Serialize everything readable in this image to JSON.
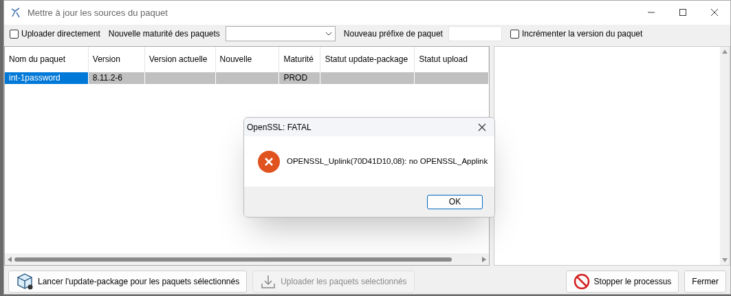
{
  "window": {
    "title": "Mettre à jour les sources du paquet"
  },
  "options": [
    {
      "kind": "checkbox",
      "label": "Uploader directement",
      "checked": false
    },
    {
      "kind": "dropdown",
      "label": "Nouvelle maturité des paquets"
    },
    {
      "kind": "textfield",
      "label": "Nouveau préfixe de paquet"
    },
    {
      "kind": "checkbox",
      "label": "Incrémenter la version du paquet",
      "checked": false
    }
  ],
  "table": {
    "columns": [
      "Nom du paquet",
      "Version",
      "Version actuelle",
      "Nouvelle",
      "Maturité",
      "Statut update-package",
      "Statut upload"
    ],
    "rows": [
      {
        "selected": true,
        "cells": [
          "int-1password",
          "8.11.2-6",
          "",
          "",
          "PROD",
          "",
          ""
        ]
      }
    ]
  },
  "buttons": [
    {
      "kind": "box",
      "label": "Lancer l'update-package pour les paquets sélectionnés",
      "disabled": false
    },
    {
      "kind": "download",
      "label": "Uploader les paquets selectionnés",
      "disabled": true
    },
    {
      "kind": "stop",
      "label": "Stopper le processus",
      "disabled": false
    },
    {
      "kind": "plain",
      "label": "Fermer",
      "disabled": false
    }
  ],
  "dialog": {
    "title": "OpenSSL: FATAL",
    "message": "OPENSSL_Uplink(70D41D10,08): no OPENSSL_Applink",
    "button": "OK"
  }
}
